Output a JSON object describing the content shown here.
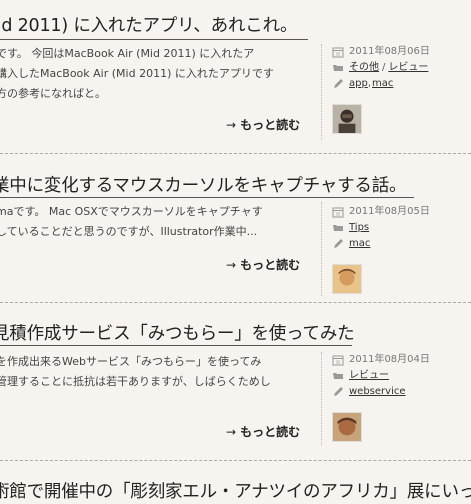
{
  "posts": [
    {
      "title": "lid 2011) に入れたアプリ、あれこれ。",
      "excerpt": [
        "です。 今回はMacBook Air (Mid 2011) に入れたア",
        "購入したMacBook Air (Mid 2011) に入れたアプリです",
        "方の参考になればと。"
      ],
      "date": "2011年08月06日",
      "categories": [
        "その他",
        "レビュー"
      ],
      "tags": [
        "app",
        "mac"
      ],
      "read_more": "もっと読む"
    },
    {
      "title": "業中に変化するマウスカーソルをキャプチャする話。",
      "excerpt": [
        "maです。 Mac OSXでマウスカーソルをキャプチャす",
        "していることだと思うのですが、Illustrator作業中..."
      ],
      "date": "2011年08月05日",
      "categories": [
        "Tips"
      ],
      "tags": [
        "mac"
      ],
      "read_more": "もっと読む"
    },
    {
      "title": "見積作成サービス「みつもらー」を使ってみた",
      "excerpt": [
        "を作成出来るWebサービス「みつもらー」を使ってみ",
        "管理することに抵抗は若干ありますが、しばらくためし",
        "。"
      ],
      "date": "2011年08月04日",
      "categories": [
        "レビュー"
      ],
      "tags": [
        "webservice"
      ],
      "read_more": "もっと読む"
    },
    {
      "title": "術館で開催中の「彫刻家エル・アナツイのアフリカ」展にいっ"
    }
  ],
  "colors": {
    "background": "#f7f4ef",
    "separator": "#aaaaaa",
    "title": "#222222"
  },
  "icons": {
    "date": "calendar-icon",
    "category": "folder-icon",
    "tag": "pencil-icon",
    "read_more": "arrow-right-icon"
  }
}
